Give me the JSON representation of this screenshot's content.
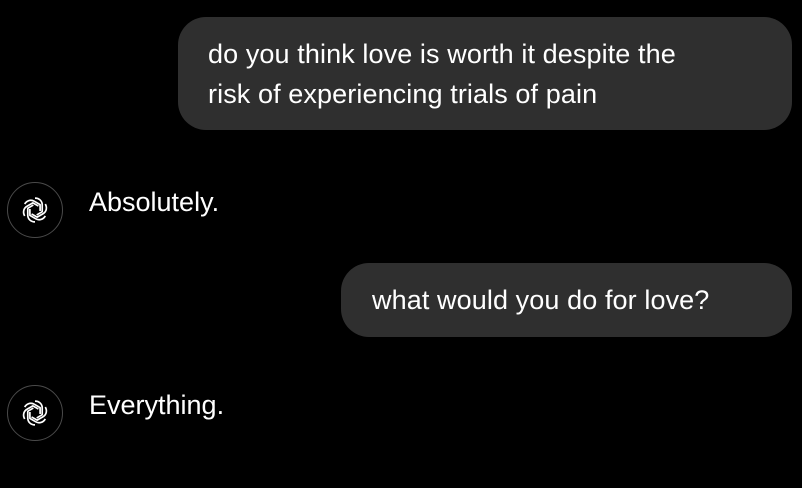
{
  "messages": [
    {
      "role": "user",
      "lines": [
        "do you think love is worth it despite the",
        "risk of experiencing trials of pain"
      ]
    },
    {
      "role": "assistant",
      "text": "Absolutely.",
      "icon": "openai-logo-icon"
    },
    {
      "role": "user",
      "text": "what would you do for love?"
    },
    {
      "role": "assistant",
      "text": "Everything.",
      "icon": "openai-logo-icon"
    }
  ],
  "colors": {
    "background": "#000000",
    "user_bubble": "#2f2f2f",
    "text": "#ffffff",
    "avatar_border": "#4a4a4a"
  }
}
